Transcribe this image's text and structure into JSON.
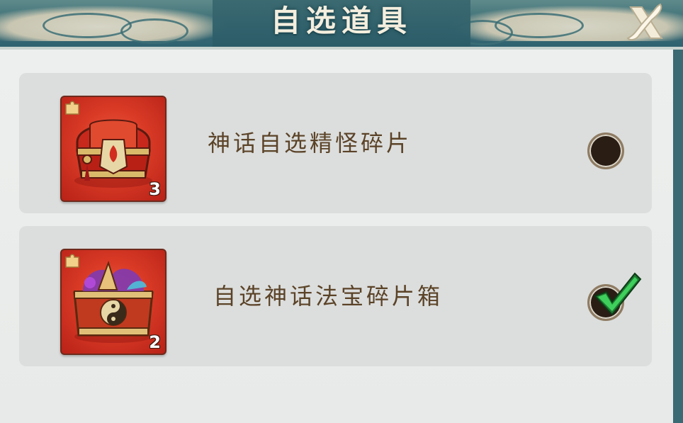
{
  "header": {
    "title": "自选道具",
    "close_icon": "close-x-icon"
  },
  "items": [
    {
      "name": "神话自选精怪碎片",
      "count": "3",
      "icon": "red-treasure-chest-icon",
      "selected": false
    },
    {
      "name": "自选神话法宝碎片箱",
      "count": "2",
      "icon": "artifact-treasure-chest-icon",
      "selected": true
    }
  ],
  "colors": {
    "header_teal": "#3d6f76",
    "card_bg": "#dcdedd",
    "text_brown": "#5b4328",
    "check_green": "#2fb34a",
    "icon_red": "#d93a26"
  }
}
